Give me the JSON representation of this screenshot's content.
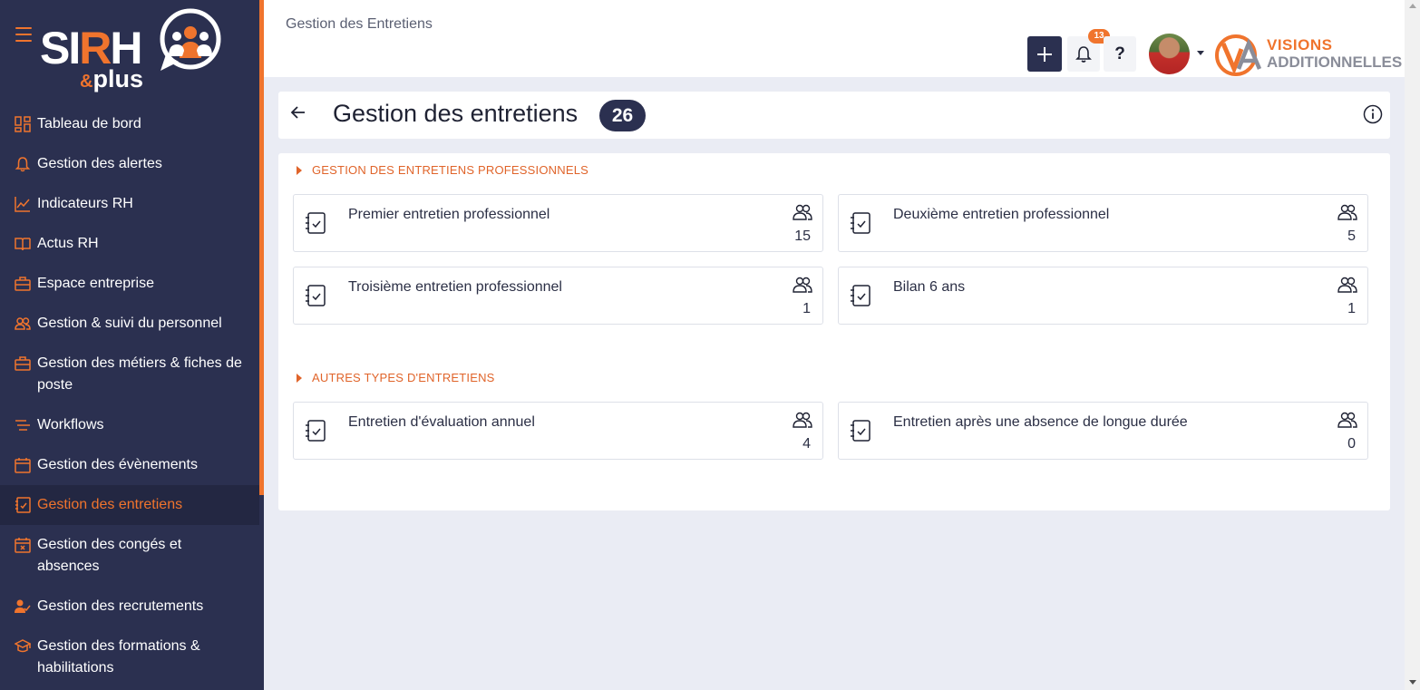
{
  "brand": {
    "logo_text": "SIRH &plus",
    "partner_logo_line1": "VISIONS",
    "partner_logo_line2": "ADDITIONNELLES",
    "accent": "#f0742d",
    "sidebar_bg": "#2b3050"
  },
  "sidebar": {
    "items": [
      {
        "label": "Tableau de bord",
        "icon": "dashboard-icon"
      },
      {
        "label": "Gestion des alertes",
        "icon": "bell-icon"
      },
      {
        "label": "Indicateurs RH",
        "icon": "line-chart-icon"
      },
      {
        "label": "Actus RH",
        "icon": "book-open-icon"
      },
      {
        "label": "Espace entreprise",
        "icon": "briefcase-icon"
      },
      {
        "label": "Gestion & suivi du personnel",
        "icon": "people-icon"
      },
      {
        "label": "Gestion des métiers & fiches de poste",
        "icon": "briefcase-icon"
      },
      {
        "label": "Workflows",
        "icon": "workflow-icon"
      },
      {
        "label": "Gestion des évènements",
        "icon": "calendar-icon"
      },
      {
        "label": "Gestion des entretiens",
        "icon": "checklist-icon",
        "active": true
      },
      {
        "label": "Gestion des congés et absences",
        "icon": "calendar-x-icon"
      },
      {
        "label": "Gestion des recrutements",
        "icon": "user-check-icon"
      },
      {
        "label": "Gestion des formations & habilitations",
        "icon": "graduation-cap-icon"
      }
    ]
  },
  "topbar": {
    "breadcrumb": "Gestion des Entretiens",
    "notifications_count": "13",
    "help_label": "?"
  },
  "header": {
    "title": "Gestion des entretiens",
    "count": "26"
  },
  "sections": [
    {
      "title": "GESTION DES ENTRETIENS PROFESSIONNELS",
      "tiles": [
        {
          "label": "Premier entretien professionnel",
          "count": "15"
        },
        {
          "label": "Deuxième entretien professionnel",
          "count": "5"
        },
        {
          "label": "Troisième entretien professionnel",
          "count": "1"
        },
        {
          "label": "Bilan 6 ans",
          "count": "1"
        }
      ]
    },
    {
      "title": "AUTRES TYPES D'ENTRETIENS",
      "tiles": [
        {
          "label": "Entretien d'évaluation annuel",
          "count": "4"
        },
        {
          "label": "Entretien après une absence de longue durée",
          "count": "0"
        }
      ]
    }
  ]
}
